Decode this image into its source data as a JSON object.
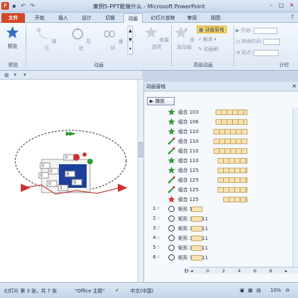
{
  "window": {
    "title": "案例5-PPT能做什么 - Microsoft PowerPoint"
  },
  "tabs": [
    {
      "label": "文件"
    },
    {
      "label": "开始"
    },
    {
      "label": "插入"
    },
    {
      "label": "设计"
    },
    {
      "label": "切换"
    },
    {
      "label": "动画"
    },
    {
      "label": "幻灯片放映"
    },
    {
      "label": "审阅"
    },
    {
      "label": "视图"
    }
  ],
  "ribbon": {
    "preview": {
      "label": "预览",
      "group": "预览"
    },
    "animations": {
      "items": [
        "弹弓",
        "形状",
        "循环"
      ],
      "group": "动画"
    },
    "effect_options": "效果选项",
    "add_animation": "添加动画",
    "animation_pane": "动画窗格",
    "trigger": "触发",
    "animation_painter": "动画刷",
    "advanced_group": "高级动画",
    "start_label": "开始:",
    "duration_label": "持续时间:",
    "delay_label": "延迟:",
    "timing_group": "计时"
  },
  "pane": {
    "title": "动画窗格",
    "play_label": "播放",
    "rows": [
      {
        "num": "",
        "label": "组合 103",
        "icon": "star-green",
        "bar_start": 0.64,
        "bar_width": 0.32,
        "ticks": true
      },
      {
        "num": "",
        "label": "组合 106",
        "icon": "star-green",
        "bar_start": 0.64,
        "bar_width": 0.32,
        "ticks": true
      },
      {
        "num": "",
        "label": "组合 110",
        "icon": "star-green",
        "bar_start": 0.62,
        "bar_width": 0.34,
        "ticks": true
      },
      {
        "num": "",
        "label": "组合 110",
        "icon": "motion-path",
        "bar_start": 0.62,
        "bar_width": 0.34,
        "ticks": true
      },
      {
        "num": "",
        "label": "组合 110",
        "icon": "motion-path",
        "bar_start": 0.62,
        "bar_width": 0.34,
        "ticks": true
      },
      {
        "num": "",
        "label": "组合 110",
        "icon": "star-green",
        "bar_start": 0.66,
        "bar_width": 0.3,
        "ticks": true
      },
      {
        "num": "",
        "label": "组合 125",
        "icon": "star-green",
        "bar_start": 0.66,
        "bar_width": 0.3,
        "ticks": true
      },
      {
        "num": "",
        "label": "组合 125",
        "icon": "motion-path",
        "bar_start": 0.66,
        "bar_width": 0.3,
        "ticks": true
      },
      {
        "num": "",
        "label": "组合 125",
        "icon": "motion-path",
        "bar_start": 0.66,
        "bar_width": 0.3,
        "ticks": true
      },
      {
        "num": "",
        "label": "组合 125",
        "icon": "star-red",
        "bar_start": 0.72,
        "bar_width": 0.24,
        "ticks": true
      },
      {
        "num": "1",
        "label": "矩形 1: 11",
        "icon": "circle",
        "bar_start": 0.4,
        "bar_width": 0.11,
        "ticks": false
      },
      {
        "num": "2",
        "label": "矩形 320: 11",
        "icon": "circle",
        "bar_start": 0.4,
        "bar_width": 0.11,
        "ticks": false
      },
      {
        "num": "3",
        "label": "矩形 321: 11",
        "icon": "circle",
        "bar_start": 0.4,
        "bar_width": 0.11,
        "ticks": false
      },
      {
        "num": "4",
        "label": "矩形 322: 11",
        "icon": "circle",
        "bar_start": 0.4,
        "bar_width": 0.11,
        "ticks": false
      },
      {
        "num": "5",
        "label": "矩形 323: 11",
        "icon": "circle",
        "bar_start": 0.4,
        "bar_width": 0.11,
        "ticks": false
      },
      {
        "num": "6",
        "label": "矩形 324: 11",
        "icon": "circle",
        "bar_start": 0.4,
        "bar_width": 0.11,
        "ticks": false
      }
    ],
    "timeline": {
      "unit": "秒",
      "ticks": [
        "0",
        "2",
        "4",
        "6",
        "8"
      ]
    }
  },
  "status": {
    "slide_info": "幻灯片 第 3 张，共 7 张",
    "theme": "\"Office 主题\"",
    "language": "中文(中国)",
    "zoom": "10%"
  },
  "colors": {
    "file_tab": "#d24726",
    "accent": "#2b5797",
    "highlight": "#ffd96a"
  }
}
